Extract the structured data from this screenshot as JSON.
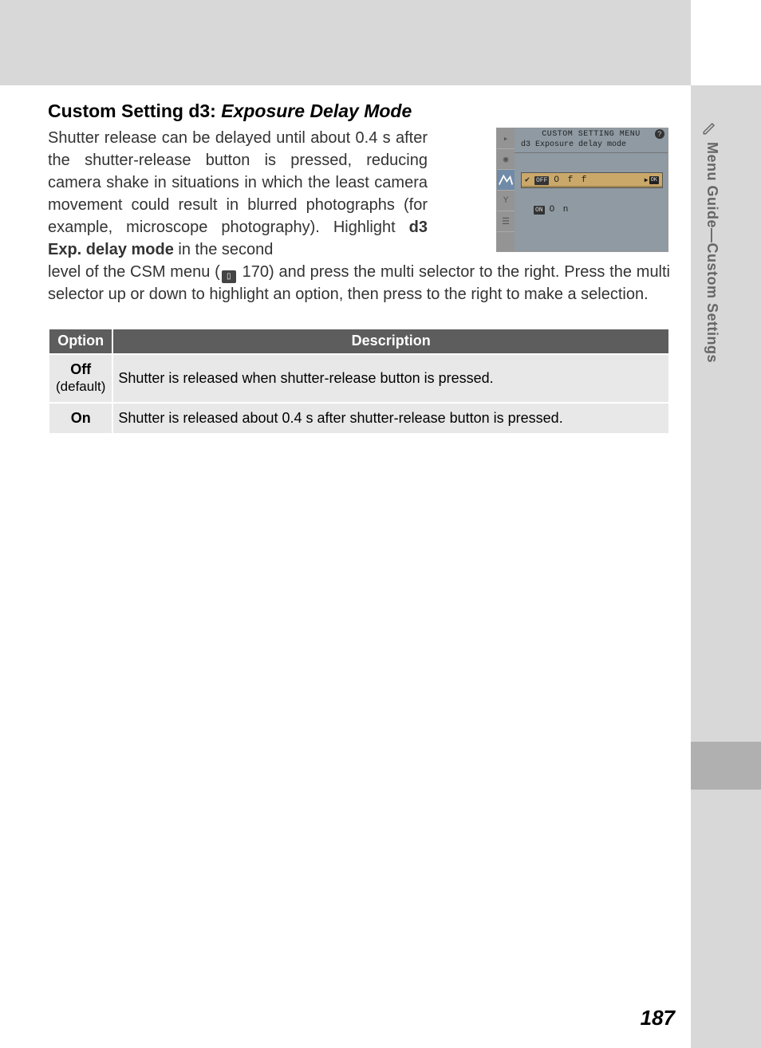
{
  "heading": {
    "prefix": "Custom Setting d3: ",
    "title_italic": "Exposure Delay Mode"
  },
  "body": {
    "p1a": "Shutter release can be delayed until about 0.4 s after the shutter-release button is pressed, reducing camera shake in situations in which the least camera movement could result in blurred photographs (for example, microscope photography). Highlight ",
    "p1b_bold": "d3 Exp. delay mode",
    "p1c": " in the second",
    "p2a": "level of the CSM menu (",
    "p2_ref": "170",
    "p2b": ") and press the multi selector to the right. Press the multi selector up or down to highlight an option, then press to the right to make a selection."
  },
  "table": {
    "headers": {
      "option": "Option",
      "description": "Description"
    },
    "rows": [
      {
        "option_bold": "Off",
        "option_sub": "(default)",
        "description": "Shutter is released when shutter-release button is pressed."
      },
      {
        "option_bold": "On",
        "option_sub": "",
        "description": "Shutter is released about 0.4 s after shutter-release button is pressed."
      }
    ]
  },
  "camera_screen": {
    "title": "CUSTOM SETTING MENU",
    "subtitle": "d3  Exposure delay mode",
    "rows": [
      {
        "check": "✔",
        "pill": "OFF",
        "label": "O f f",
        "selected": true,
        "ok": "OK"
      },
      {
        "check": "",
        "pill": "ON",
        "label": "O n",
        "selected": false
      }
    ],
    "help": "?"
  },
  "side_tab": {
    "text": "Menu Guide—Custom Settings"
  },
  "page_number": "187"
}
